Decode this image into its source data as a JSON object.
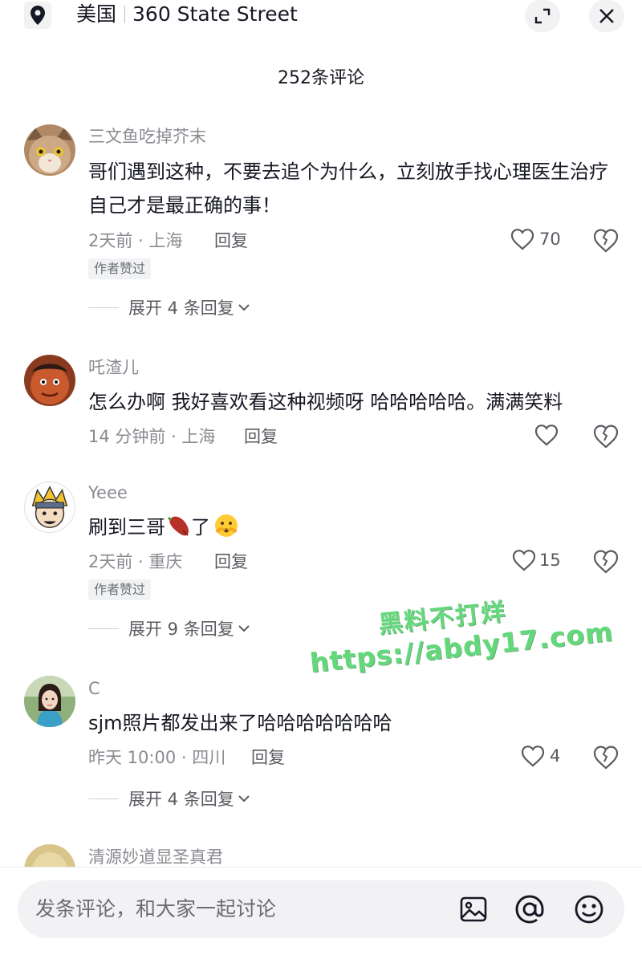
{
  "header": {
    "country": "美国",
    "address": "360 State Street",
    "icons": [
      "location-pin-icon",
      "expand-icon",
      "close-icon"
    ]
  },
  "comment_count": "252条评论",
  "comments": [
    {
      "username": "三文鱼吃掉芥末",
      "avatar": "cat-avatar",
      "text": "哥们遇到这种，不要去追个为什么，立刻放手找心理医生治疗自己才是最正确的事！",
      "time_location": "2天前 · 上海",
      "reply_label": "回复",
      "likes": "70",
      "badge": "作者赞过",
      "expand_label": "展开 4 条回复"
    },
    {
      "username": "吒渣儿",
      "avatar": "nezha-avatar",
      "text": "怎么办啊 我好喜欢看这种视频呀 哈哈哈哈哈。满满笑料",
      "time_location": "14 分钟前 · 上海",
      "reply_label": "回复",
      "likes": ""
    },
    {
      "username": "Yeee",
      "avatar": "cartoon-ninja-avatar",
      "text_before": "刷到三哥",
      "text_after": "了",
      "text_emojis": [
        "sweet-potato-emoji",
        "peeking-face-emoji"
      ],
      "time_location": "2天前 · 重庆",
      "reply_label": "回复",
      "likes": "15",
      "badge": "作者赞过",
      "expand_label": "展开 9 条回复"
    },
    {
      "username": "C",
      "avatar": "girl-photo-avatar",
      "text": "sjm照片都发出来了哈哈哈哈哈哈哈",
      "time_location": "昨天 10:00 · 四川",
      "reply_label": "回复",
      "likes": "4",
      "expand_label": "展开 4 条回复"
    },
    {
      "username": "清源妙道显圣真君",
      "avatar": "golden-avatar"
    }
  ],
  "watermark": {
    "line1": "黑料不打烊",
    "line2": "https://abdy17.com"
  },
  "input": {
    "placeholder": "发条评论，和大家一起讨论",
    "icons": [
      "image-icon",
      "at-icon",
      "emoji-icon"
    ]
  },
  "colors": {
    "text": "#161823",
    "secondary": "#8a8b91",
    "watermark": "#62d87a"
  }
}
